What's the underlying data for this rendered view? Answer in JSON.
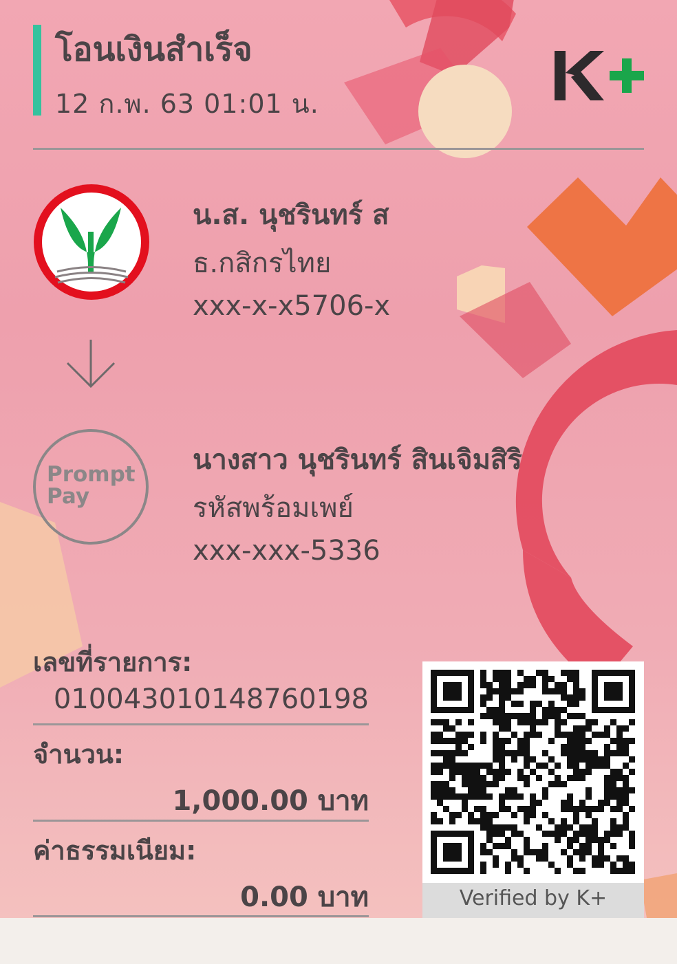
{
  "header": {
    "title": "โอนเงินสำเร็จ",
    "datetime": "12 ก.พ. 63  01:01 น.",
    "logo_text": "K+"
  },
  "sender": {
    "name": "น.ส. นุชรินทร์ ส",
    "bank": "ธ.กสิกรไทย",
    "account": "xxx-x-x5706-x"
  },
  "receiver": {
    "name": "นางสาว นุชรินทร์ สินเจิมสิริ",
    "type": "รหัสพร้อมเพย์",
    "account": "xxx-xxx-5336",
    "icon_text_1": "Prompt",
    "icon_text_2": "Pay"
  },
  "details": {
    "ref_label": "เลขที่รายการ:",
    "ref_value": "010043010148760198",
    "amount_label": "จำนวน:",
    "amount_value": "1,000.00 บาท",
    "fee_label": "ค่าธรรมเนียม:",
    "fee_value": "0.00 บาท"
  },
  "qr": {
    "caption": "Verified by K+"
  },
  "colors": {
    "accent": "#35c29e",
    "kbank_green": "#1aa64b",
    "kbank_red": "#e3101e",
    "text": "#4b4447"
  }
}
